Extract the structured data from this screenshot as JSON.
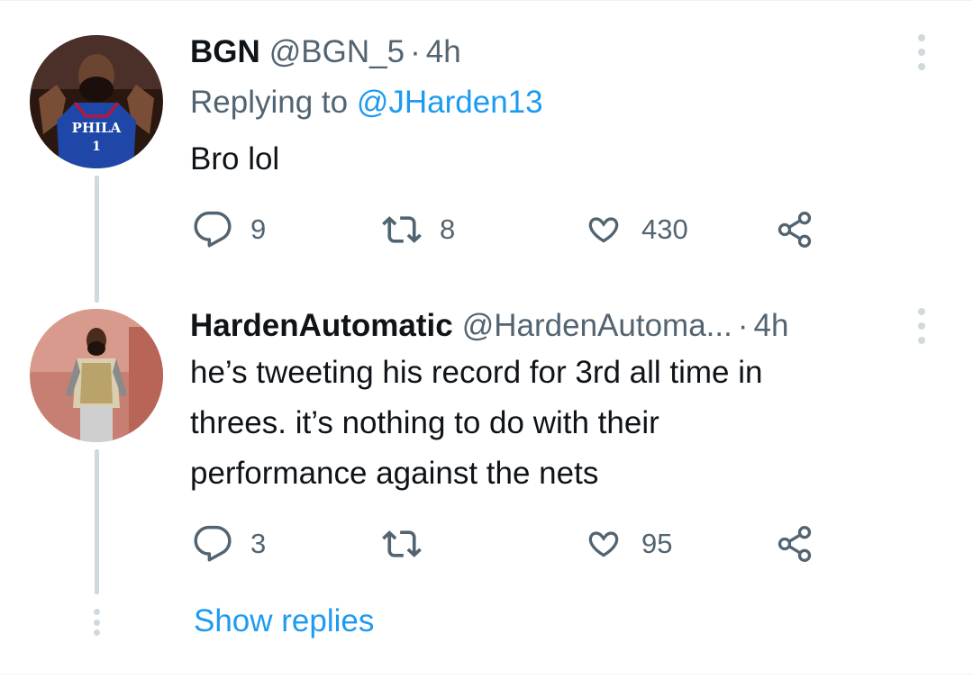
{
  "tweets": [
    {
      "display_name": "BGN",
      "handle": "@BGN_5",
      "separator": "·",
      "time": "4h",
      "replying_label": "Replying to",
      "replying_to": "@JHarden13",
      "text_lines": [
        "Bro lol"
      ],
      "stats": {
        "replies": "9",
        "retweets": "8",
        "likes": "430"
      },
      "avatar": {
        "jersey_text": "PHILA",
        "jersey_number": "1"
      }
    },
    {
      "display_name": "HardenAutomatic",
      "handle": "@HardenAutoma...",
      "separator": "·",
      "time": "4h",
      "text_lines": [
        "he’s tweeting his record for 3rd all time in",
        "threes. it’s nothing to do with their",
        "performance against the nets"
      ],
      "stats": {
        "replies": "3",
        "retweets": "",
        "likes": "95"
      }
    }
  ],
  "show_replies_label": "Show replies",
  "icons": {
    "reply": "reply-icon",
    "retweet": "retweet-icon",
    "like": "heart-icon",
    "share": "share-icon",
    "more": "more-vertical-icon"
  },
  "colors": {
    "text": "#0f1419",
    "secondary": "#536471",
    "link": "#1d9bf0",
    "line": "#cfd9de"
  }
}
